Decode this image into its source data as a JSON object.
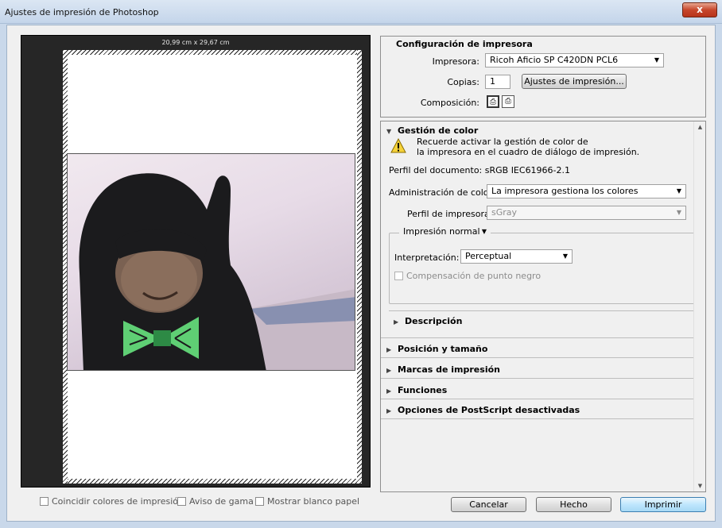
{
  "window": {
    "title": "Ajustes de impresión de Photoshop",
    "close_label": "x"
  },
  "preview": {
    "dimensions": "20,99 cm x 29,67 cm"
  },
  "bottom_options": [
    {
      "label": "Coincidir colores de impresión",
      "checked": false
    },
    {
      "label": "Aviso de gama",
      "checked": false
    },
    {
      "label": "Mostrar blanco papel",
      "checked": false
    }
  ],
  "printer_setup": {
    "title": "Configuración de impresora",
    "printer_label": "Impresora:",
    "printer_value": "Ricoh Aficio SP C420DN PCL6",
    "copies_label": "Copias:",
    "copies_value": "1",
    "print_settings_button": "Ajustes de impresión...",
    "layout_label": "Composición:"
  },
  "color_management": {
    "title": "Gestión de color",
    "warning_line1": "Recuerde activar la gestión de color de",
    "warning_line2": "la impresora en el cuadro de diálogo de impresión.",
    "document_profile": "Perfil del documento: sRGB IEC61966-2.1",
    "color_handling_label": "Administración de color:",
    "color_handling_value": "La impresora gestiona los colores",
    "printer_profile_label": "Perfil de impresora:",
    "printer_profile_value": "sGray",
    "print_mode_value": "Impresión normal",
    "rendering_label": "Interpretación:",
    "rendering_value": "Perceptual",
    "black_point_label": "Compensación de punto negro",
    "description_label": "Descripción"
  },
  "sections": [
    "Posición y tamaño",
    "Marcas de impresión",
    "Funciones",
    "Opciones de PostScript desactivadas"
  ],
  "buttons": {
    "cancel": "Cancelar",
    "done": "Hecho",
    "print": "Imprimir"
  }
}
